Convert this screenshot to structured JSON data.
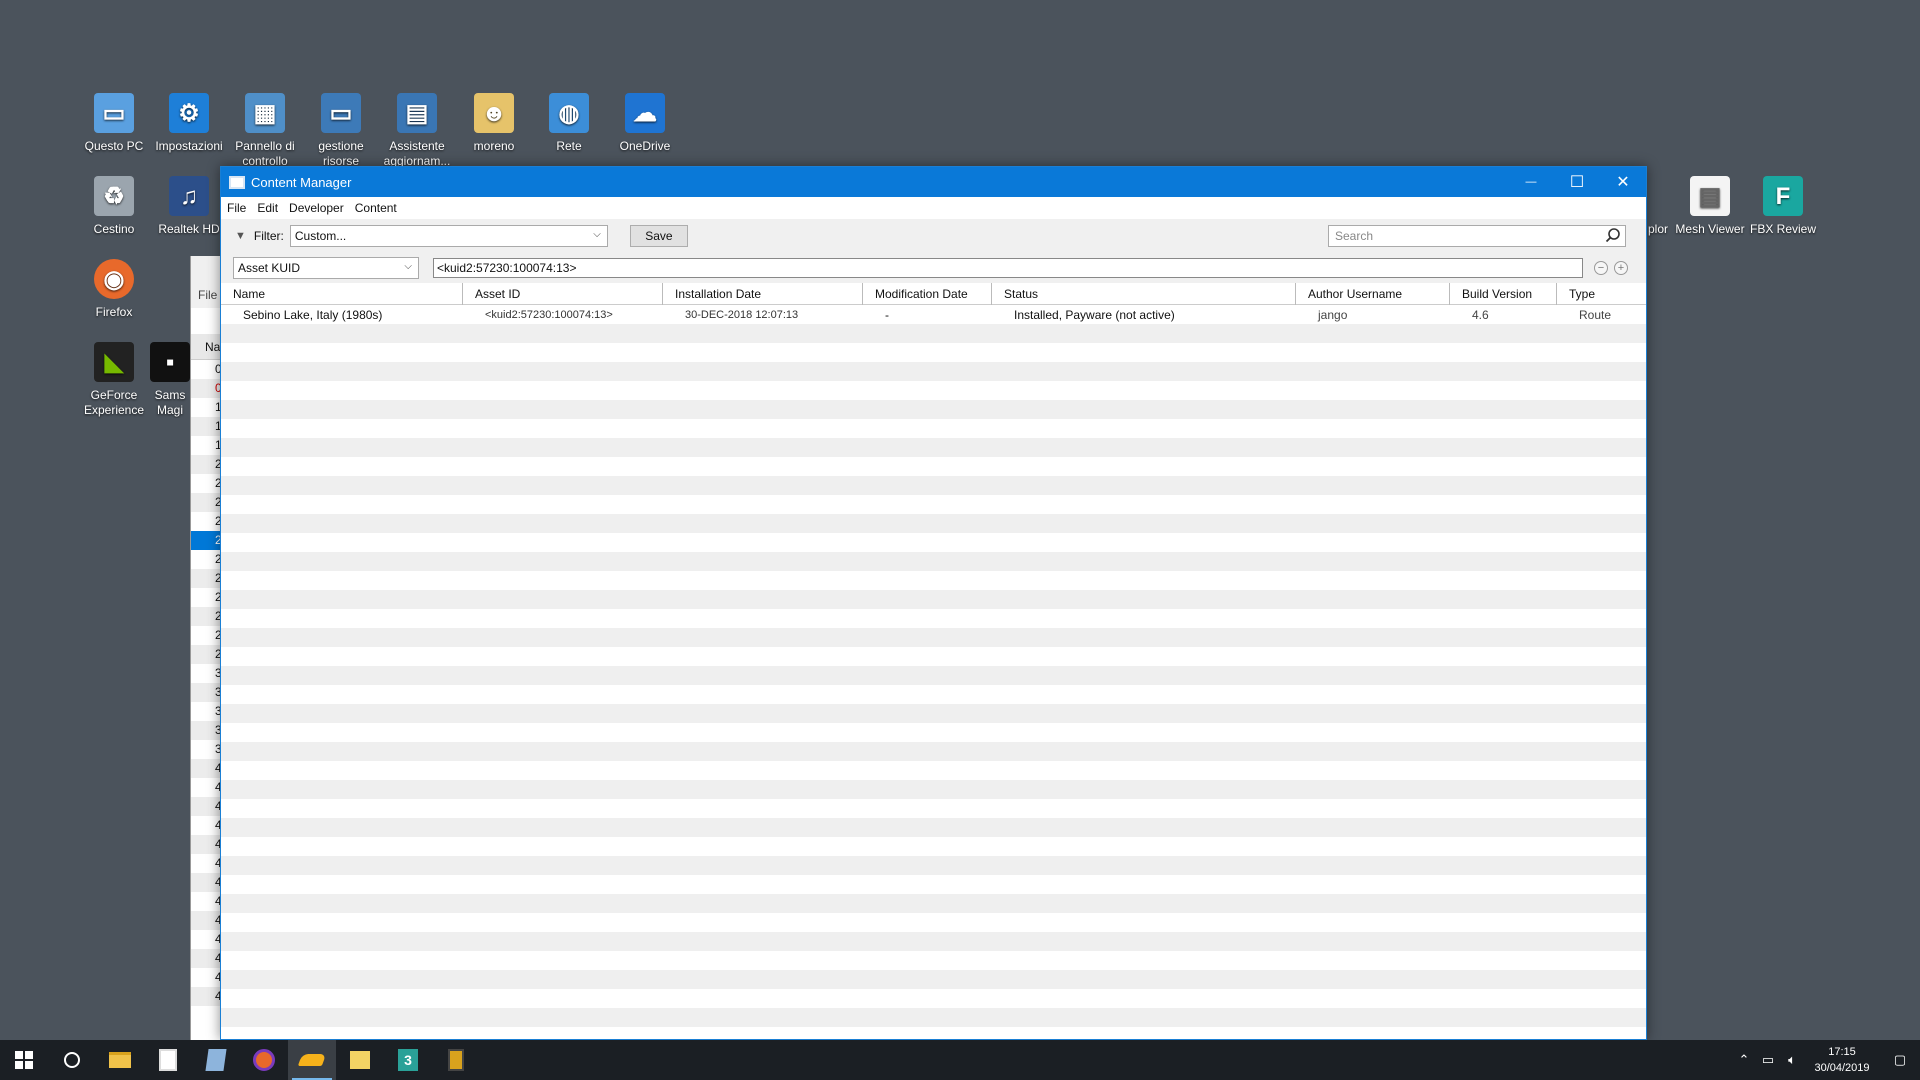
{
  "desktop": {
    "icons": [
      {
        "label": "Questo PC"
      },
      {
        "label": "Impostazioni"
      },
      {
        "label": "Pannello di controllo"
      },
      {
        "label": "gestione risorse"
      },
      {
        "label": "Assistente aggiornam..."
      },
      {
        "label": "moreno"
      },
      {
        "label": "Rete"
      },
      {
        "label": "OneDrive"
      },
      {
        "label": "Cestino"
      },
      {
        "label": "Realtek HD"
      },
      {
        "label": "Firefox"
      },
      {
        "label": "GeForce Experience"
      },
      {
        "label": "Sams Magi"
      },
      {
        "label": "plor"
      },
      {
        "label": "Mesh Viewer"
      },
      {
        "label": "FBX Review"
      }
    ]
  },
  "bg_window": {
    "menu": "File",
    "header": "Na",
    "row_digits": [
      "0",
      "0",
      "1",
      "1",
      "1",
      "2",
      "2",
      "2",
      "2",
      "2",
      "2",
      "2",
      "2",
      "2",
      "2",
      "2",
      "3",
      "3",
      "3",
      "3",
      "3",
      "4",
      "4",
      "4",
      "4",
      "4",
      "4",
      "4",
      "4",
      "4",
      "4",
      "4",
      "4",
      "4"
    ]
  },
  "window": {
    "title": "Content Manager",
    "controls": {
      "minimize": "—",
      "maximize": "☐",
      "close": "✕"
    },
    "menu": [
      "File",
      "Edit",
      "Developer",
      "Content"
    ],
    "filter": {
      "label": "Filter:",
      "value": "Custom...",
      "save": "Save",
      "search_placeholder": "Search"
    },
    "kuid": {
      "field": "Asset KUID",
      "value": "<kuid2:57230:100074:13>",
      "minus": "−",
      "plus": "+"
    },
    "columns": [
      "Name",
      "Asset ID",
      "Installation Date",
      "Modification Date",
      "Status",
      "Author Username",
      "Build Version",
      "Type"
    ],
    "rows": [
      {
        "name": "Sebino Lake, Italy (1980s)",
        "asset_id": "<kuid2:57230:100074:13>",
        "installation_date": "30-DEC-2018 12:07:13",
        "modification_date": "-",
        "status": "Installed, Payware (not active)",
        "author": "jango",
        "build": "4.6",
        "type": "Route"
      }
    ]
  },
  "taskbar": {
    "time": "17:15",
    "date": "30/04/2019"
  }
}
